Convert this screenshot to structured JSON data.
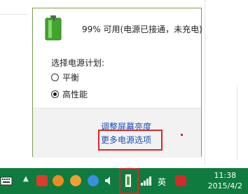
{
  "flyout": {
    "status": "99% 可用(电源已接通，未充电)",
    "plan_label": "选择电源计划:",
    "plans": [
      {
        "label": "平衡",
        "selected": false
      },
      {
        "label": "高性能",
        "selected": true
      }
    ],
    "link_brightness": "调整屏幕亮度",
    "link_more_options": "更多电源选项"
  },
  "taskbar": {
    "time": "11:38",
    "date": "2015/4/2",
    "ime_label": "英",
    "highlight_color": "#d9262c",
    "battery_color": "#3fa62b"
  }
}
